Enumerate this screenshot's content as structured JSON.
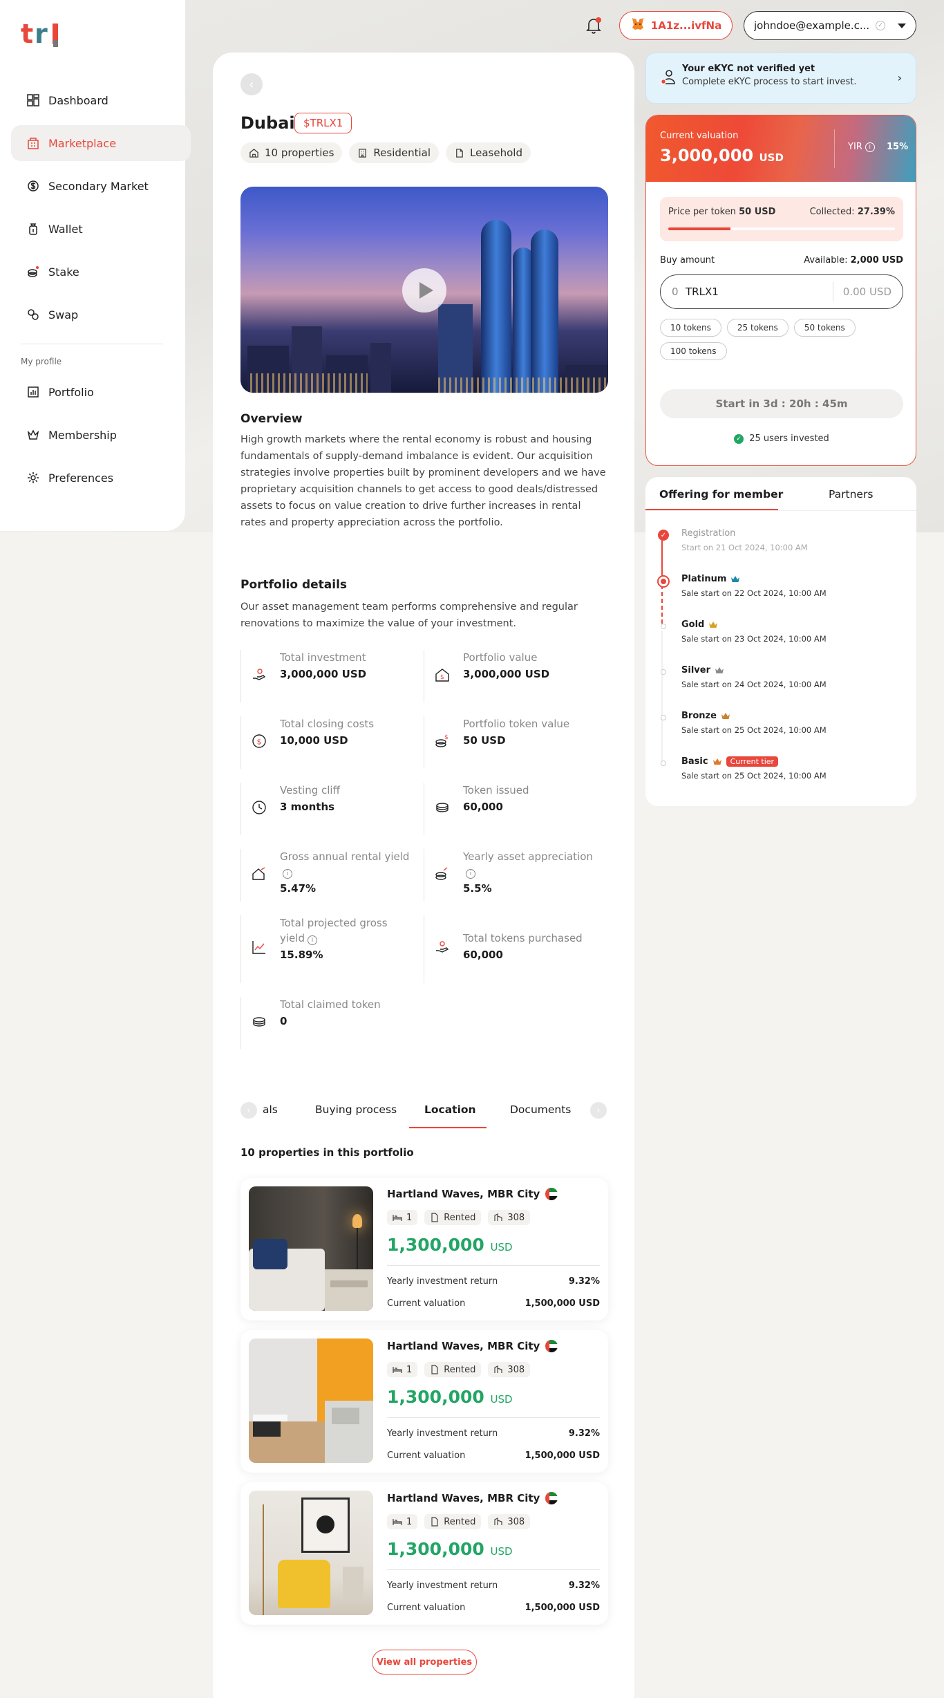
{
  "brand": {
    "logo_text": "trl"
  },
  "nav": {
    "items": [
      {
        "label": "Dashboard",
        "icon": "dashboard-icon"
      },
      {
        "label": "Marketplace",
        "icon": "marketplace-icon"
      },
      {
        "label": "Secondary Market",
        "icon": "secondary-market-icon"
      },
      {
        "label": "Wallet",
        "icon": "wallet-icon"
      },
      {
        "label": "Stake",
        "icon": "stake-icon"
      },
      {
        "label": "Swap",
        "icon": "swap-icon"
      }
    ],
    "profile_section_label": "My profile",
    "profile_items": [
      {
        "label": "Portfolio",
        "icon": "portfolio-icon"
      },
      {
        "label": "Membership",
        "icon": "crown-icon"
      },
      {
        "label": "Preferences",
        "icon": "gear-icon"
      }
    ]
  },
  "topbar": {
    "wallet_address": "1A1z...ivfNa",
    "user_email": "johndoe@example.c..."
  },
  "property": {
    "title": "Dubai",
    "ticker": "$TRLX1",
    "chips": [
      "10 properties",
      "Residential",
      "Leasehold"
    ],
    "overview_heading": "Overview",
    "overview_text": "High growth markets where the rental economy is robust and housing fundamentals of supply-demand imbalance is evident. Our acquisition strategies involve properties built by prominent developers and we have proprietary acquisition channels to get access to good deals/distressed assets to focus on value creation to drive further increases in rental rates and property appreciation across the portfolio.",
    "portfolio_heading": "Portfolio details",
    "portfolio_text": "Our asset management team performs comprehensive and regular renovations to maximize the value of your investment."
  },
  "details": [
    {
      "label": "Total investment",
      "value": "3,000,000 USD",
      "icon": "hand-coin-icon"
    },
    {
      "label": "Portfolio value",
      "value": "3,000,000 USD",
      "icon": "house-dollar-icon"
    },
    {
      "label": "Total closing costs",
      "value": "10,000 USD",
      "icon": "dollar-circle-icon"
    },
    {
      "label": "Portfolio token value",
      "value": "50 USD",
      "icon": "coins-icon"
    },
    {
      "label": "Vesting cliff",
      "value": "3 months",
      "icon": "clock-icon"
    },
    {
      "label": "Token issued",
      "value": "60,000",
      "icon": "token-stack-icon"
    },
    {
      "label": "Gross annual rental yield",
      "value": "5.47%",
      "icon": "house-growth-icon"
    },
    {
      "label": "Yearly asset appreciation",
      "value": "5.5%",
      "icon": "coins-growth-icon"
    },
    {
      "label": "Total projected gross yield",
      "value": "15.89%",
      "icon": "line-chart-icon"
    },
    {
      "label": "Total tokens purchased",
      "value": "60,000",
      "icon": "hand-user-icon"
    },
    {
      "label": "Total claimed token",
      "value": "0",
      "icon": "token-stack-icon"
    }
  ],
  "tabs": {
    "items": [
      "als",
      "Buying process",
      "Location",
      "Documents"
    ],
    "active": "Location"
  },
  "properties_heading": "10 properties in this portfolio",
  "properties": [
    {
      "name": "Hartland Waves, MBR City",
      "beds": "1",
      "status": "Rented",
      "area": "308",
      "price": "1,300,000",
      "currency": "USD",
      "yield_label": "Yearly investment return",
      "yield": "9.32%",
      "valuation_label": "Current valuation",
      "valuation": "1,500,000 USD"
    },
    {
      "name": "Hartland Waves, MBR City",
      "beds": "1",
      "status": "Rented",
      "area": "308",
      "price": "1,300,000",
      "currency": "USD",
      "yield_label": "Yearly investment return",
      "yield": "9.32%",
      "valuation_label": "Current valuation",
      "valuation": "1,500,000 USD"
    },
    {
      "name": "Hartland Waves, MBR City",
      "beds": "1",
      "status": "Rented",
      "area": "308",
      "price": "1,300,000",
      "currency": "USD",
      "yield_label": "Yearly investment return",
      "yield": "9.32%",
      "valuation_label": "Current valuation",
      "valuation": "1,500,000 USD"
    }
  ],
  "view_all_label": "View all properties",
  "kyc": {
    "title": "Your eKYC not verified yet",
    "subtitle": "Complete eKYC process to start invest."
  },
  "invest": {
    "valuation_label": "Current valuation",
    "valuation_value": "3,000,000",
    "valuation_currency": "USD",
    "yir_label": "YIR",
    "yir_value": "15%",
    "price_label": "Price per token",
    "price_value": "50 USD",
    "collected_label": "Collected:",
    "collected_value": "27.39%",
    "collected_fraction": 0.2739,
    "buy_label": "Buy amount",
    "available_label": "Available:",
    "available_value": "2,000 USD",
    "qty_placeholder": "0",
    "token_symbol": "TRLX1",
    "usd_placeholder": "0.00 USD",
    "presets": [
      "10 tokens",
      "25 tokens",
      "50 tokens",
      "100 tokens"
    ],
    "start_label": "Start in 3d : 20h : 45m",
    "investors_label": "25 users invested"
  },
  "offering": {
    "tabs": [
      "Offering for member",
      "Partners"
    ],
    "tiers": [
      {
        "name": "Registration",
        "sub": "Start on 21 Oct 2024, 10:00 AM",
        "state": "done"
      },
      {
        "name": "Platinum",
        "sub": "Sale start on 22 Oct 2024, 10:00 AM",
        "state": "current",
        "crown": "#1e88a8"
      },
      {
        "name": "Gold",
        "sub": "Sale start on 23 Oct 2024, 10:00 AM",
        "state": "future",
        "crown": "#d9a02b"
      },
      {
        "name": "Silver",
        "sub": "Sale start on 24 Oct 2024, 10:00 AM",
        "state": "future",
        "crown": "#8a8a8a"
      },
      {
        "name": "Bronze",
        "sub": "Sale start on 25 Oct 2024, 10:00 AM",
        "state": "future",
        "crown": "#c9822e"
      },
      {
        "name": "Basic",
        "sub": "Sale start on 25 Oct 2024, 10:00 AM",
        "state": "future",
        "crown": "#e07a2a",
        "badge": "Current tier"
      }
    ]
  },
  "colors": {
    "accent": "#e8473b",
    "price_green": "#22a565",
    "kyc_bg": "#e3f3fb"
  }
}
